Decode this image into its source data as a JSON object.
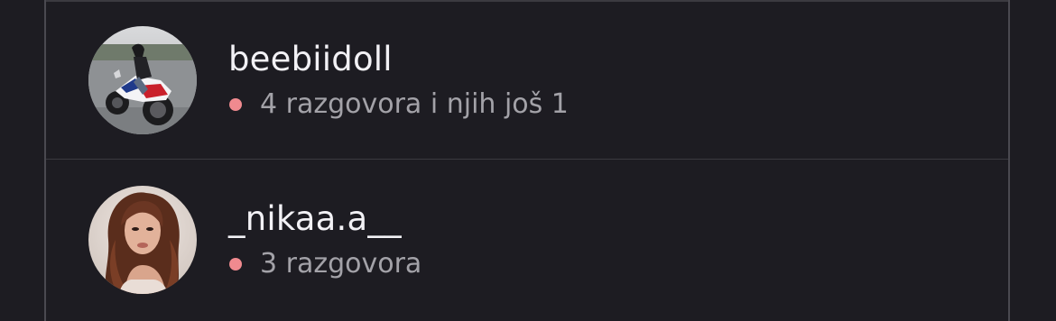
{
  "colors": {
    "background": "#1d1c22",
    "unread_dot": "#f08a8f",
    "username_text": "#f2f1f5",
    "status_text": "#a3a2a8"
  },
  "conversations": [
    {
      "username": "beebiidoll",
      "status": "4 razgovora i njih još 1",
      "avatar": "motorcycle-rider-photo",
      "unread": true
    },
    {
      "username": "_nikaa.a__",
      "status": "3 razgovora",
      "avatar": "woman-portrait-photo",
      "unread": true
    }
  ]
}
